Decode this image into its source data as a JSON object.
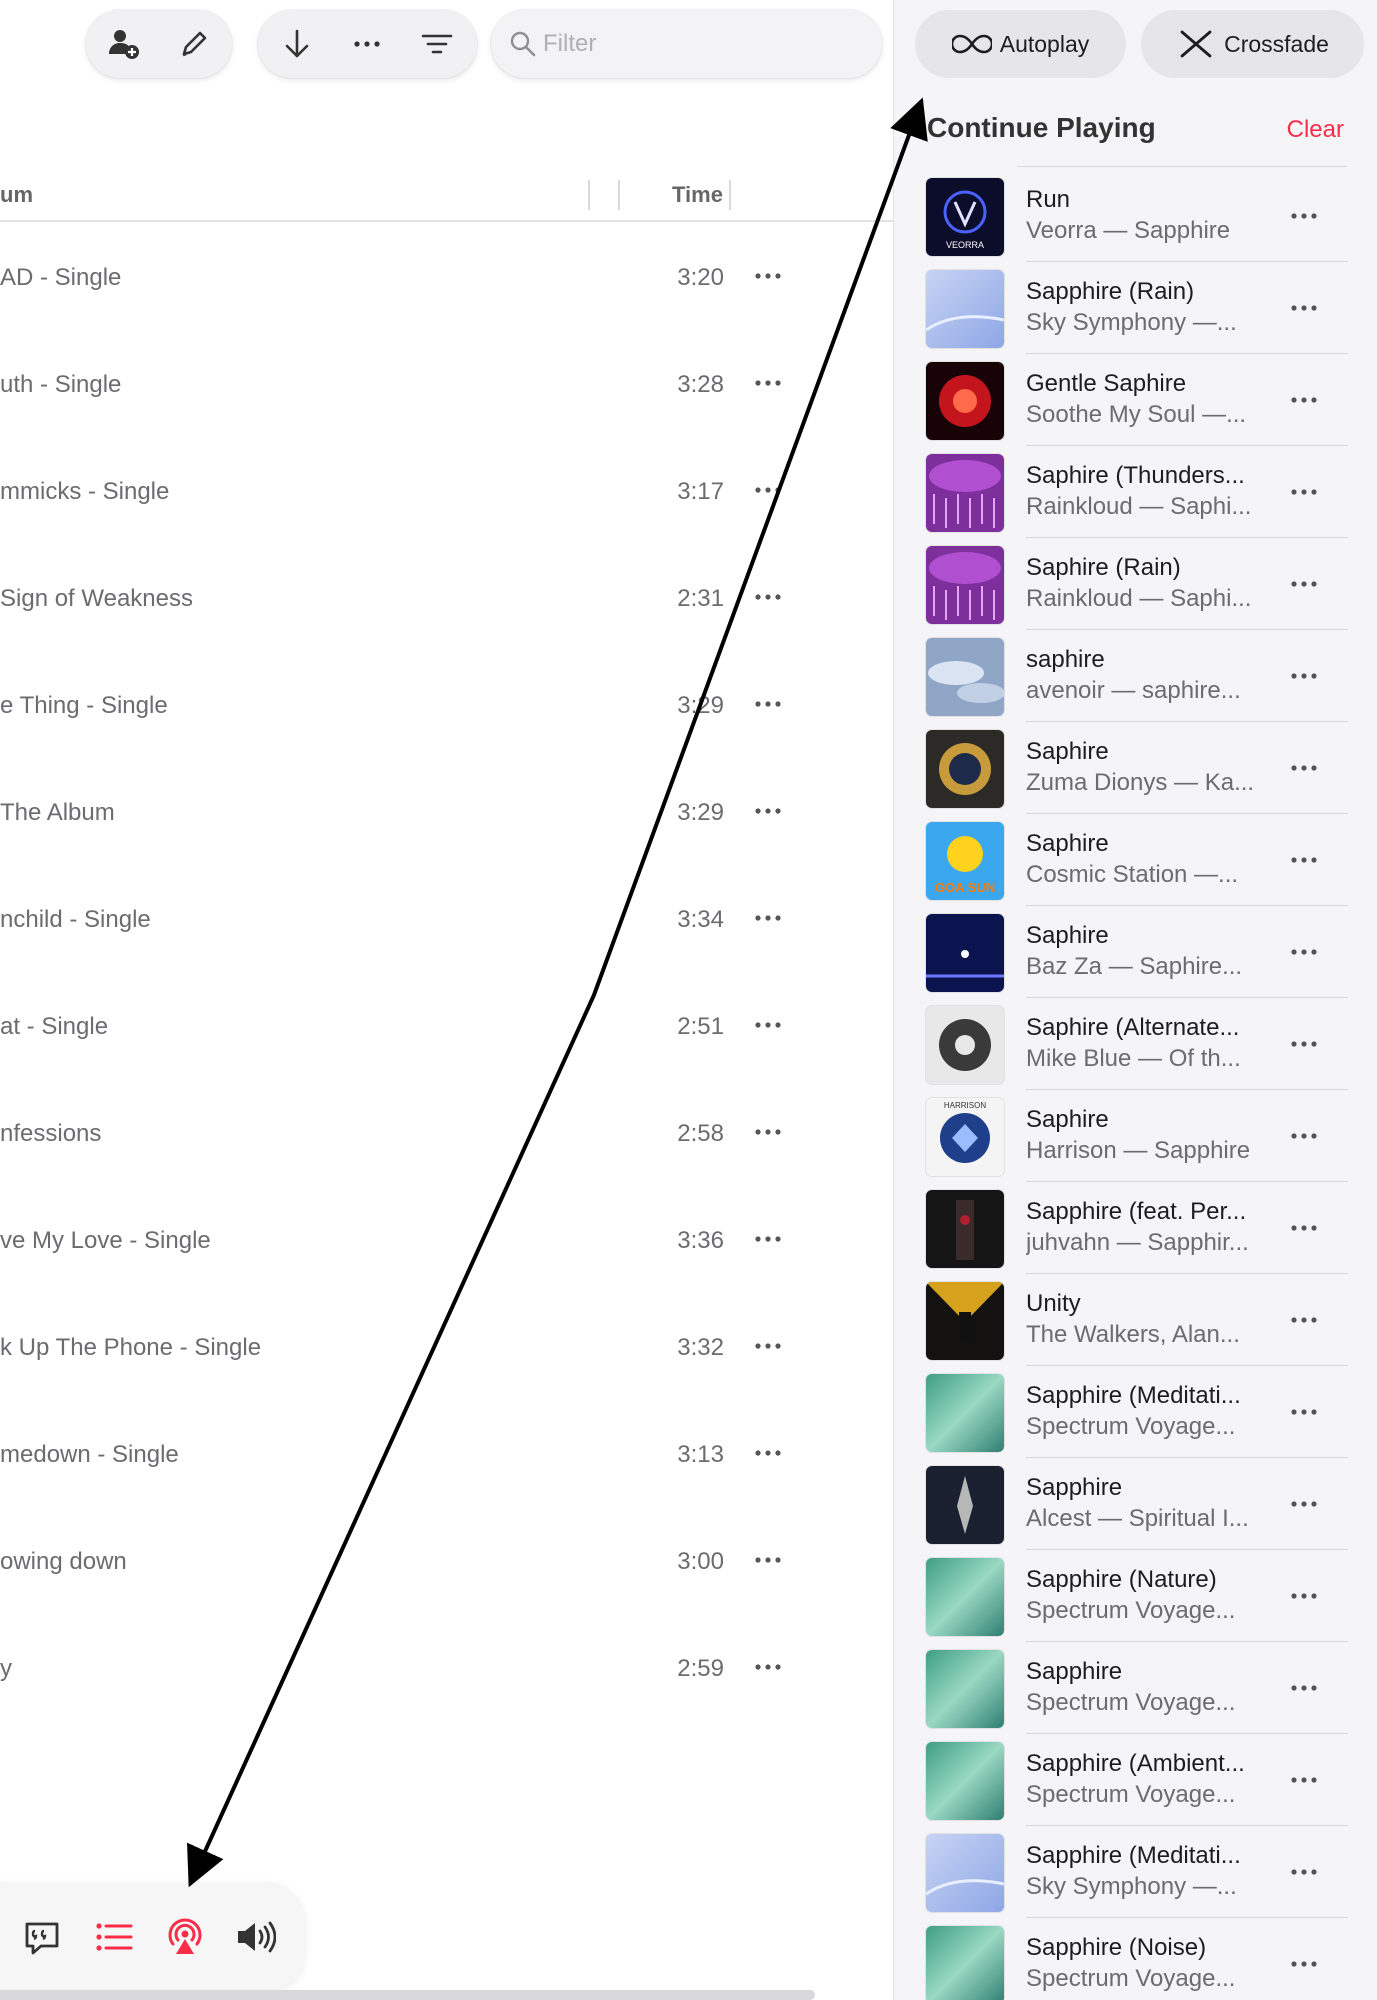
{
  "toolbar": {
    "group1": [
      {
        "icon": "add-person-icon"
      },
      {
        "icon": "pencil-icon"
      }
    ],
    "group2": [
      {
        "icon": "download-arrow-icon"
      },
      {
        "icon": "more-icon"
      },
      {
        "icon": "sort-lines-icon"
      }
    ],
    "filter_placeholder": "Filter",
    "filter_icon": "search-icon"
  },
  "columns": {
    "album": "um",
    "time": "Time"
  },
  "songs": [
    {
      "album": "AD - Single",
      "time": "3:20"
    },
    {
      "album": "uth - Single",
      "time": "3:28"
    },
    {
      "album": "mmicks - Single",
      "time": "3:17"
    },
    {
      "album": " Sign of Weakness",
      "time": "2:31"
    },
    {
      "album": "e Thing - Single",
      "time": "3:29"
    },
    {
      "album": " The Album",
      "time": "3:29"
    },
    {
      "album": "nchild - Single",
      "time": "3:34"
    },
    {
      "album": "at - Single",
      "time": "2:51"
    },
    {
      "album": "nfessions",
      "time": "2:58"
    },
    {
      "album": "ve My Love - Single",
      "time": "3:36"
    },
    {
      "album": "k Up The Phone - Single",
      "time": "3:32"
    },
    {
      "album": "medown - Single",
      "time": "3:13"
    },
    {
      "album": "owing down",
      "time": "3:00"
    },
    {
      "album": "y",
      "time": "2:59"
    }
  ],
  "player_controls": [
    {
      "icon": "lyrics-icon"
    },
    {
      "icon": "queue-list-icon"
    },
    {
      "icon": "airplay-icon"
    },
    {
      "icon": "volume-icon"
    }
  ],
  "queue_panel": {
    "autoplay_label": "Autoplay",
    "crossfade_label": "Crossfade",
    "title": "Continue Playing",
    "clear_label": "Clear",
    "accent_color": "#fa2d48"
  },
  "queue": [
    {
      "title": "Run",
      "subtitle": "Veorra — Sapphire",
      "art": "veorra",
      "art_text": "VEORRA"
    },
    {
      "title": "Sapphire (Rain)",
      "subtitle": "Sky Symphony —...",
      "art": "sky"
    },
    {
      "title": "Gentle Saphire",
      "subtitle": "Soothe My Soul —...",
      "art": "red"
    },
    {
      "title": "Saphire (Thunders...",
      "subtitle": "Rainkloud — Saphi...",
      "art": "purple"
    },
    {
      "title": "Saphire (Rain)",
      "subtitle": "Rainkloud — Saphi...",
      "art": "purple"
    },
    {
      "title": "saphire",
      "subtitle": "avenoir — saphire...",
      "art": "clouds"
    },
    {
      "title": "Saphire",
      "subtitle": "Zuma Dionys — Ka...",
      "art": "zuma"
    },
    {
      "title": "Saphire",
      "subtitle": "Cosmic Station —...",
      "art": "goasun",
      "art_text": "GOA SUN"
    },
    {
      "title": "Saphire",
      "subtitle": "Baz Za — Saphire...",
      "art": "space"
    },
    {
      "title": "Saphire (Alternate...",
      "subtitle": "Mike Blue — Of th...",
      "art": "mandala"
    },
    {
      "title": "Saphire",
      "subtitle": "Harrison — Sapphire",
      "art": "harrison",
      "art_text": "HARRISON"
    },
    {
      "title": "Sapphire (feat. Per...",
      "subtitle": "juhvahn — Sapphir...",
      "art": "dark"
    },
    {
      "title": "Unity",
      "subtitle": "The Walkers, Alan...",
      "art": "unity"
    },
    {
      "title": "Sapphire (Meditati...",
      "subtitle": "Spectrum Voyage...",
      "art": "spectrum"
    },
    {
      "title": "Sapphire",
      "subtitle": "Alcest — Spiritual I...",
      "art": "alcest"
    },
    {
      "title": "Sapphire (Nature)",
      "subtitle": "Spectrum Voyage...",
      "art": "spectrum"
    },
    {
      "title": "Sapphire",
      "subtitle": "Spectrum Voyage...",
      "art": "spectrum"
    },
    {
      "title": "Sapphire (Ambient...",
      "subtitle": "Spectrum Voyage...",
      "art": "spectrum"
    },
    {
      "title": "Sapphire (Meditati...",
      "subtitle": "Sky Symphony —...",
      "art": "sky"
    },
    {
      "title": "Sapphire (Noise)",
      "subtitle": "Spectrum Voyage...",
      "art": "spectrum"
    }
  ]
}
